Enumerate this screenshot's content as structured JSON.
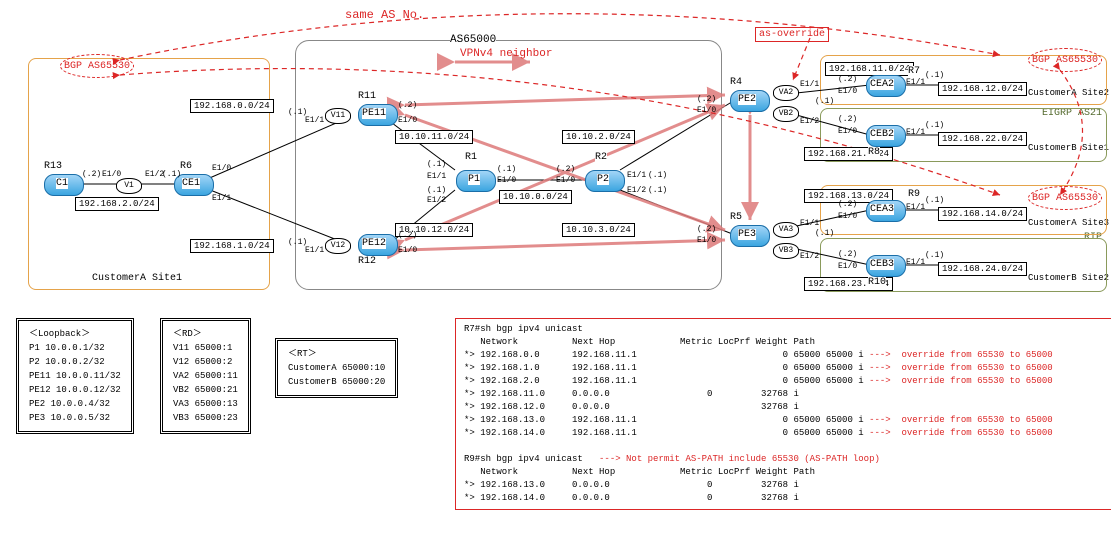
{
  "annotations": {
    "same_as": "same AS No.",
    "as_override": "as-override",
    "as65000": "AS65000",
    "vpnv4": "VPNv4 neighbor",
    "bgp65530": "BGP AS65530",
    "eigrp": "EIGRP AS21",
    "rip": "RIP",
    "custA1": "CustomerA Site1",
    "custA2": "CustomerA Site2",
    "custA3": "CustomerA Site3",
    "custB1": "CustomerB Site1",
    "custB2": "CustomerB Site2"
  },
  "routers": {
    "R1": "R1",
    "R2": "R2",
    "R4": "R4",
    "R5": "R5",
    "R6": "R6",
    "R7": "R7",
    "R8": "R8",
    "R9": "R9",
    "R10": "R10",
    "R11": "R11",
    "R12": "R12",
    "R13": "R13",
    "P1": "P1",
    "P2": "P2",
    "PE11": "PE11",
    "PE12": "PE12",
    "PE2": "PE2",
    "PE3": "PE3",
    "CE1": "CE1",
    "C1": "C1",
    "CEA2": "CEA2",
    "CEB2": "CEB2",
    "CEA3": "CEA3",
    "CEB3": "CEB3",
    "V1": "V1",
    "V11": "V11",
    "V12": "V12",
    "VA2": "VA2",
    "VB2": "VB2",
    "VA3": "VA3",
    "VB3": "VB3"
  },
  "nets": {
    "n_192_168_0": "192.168.0.0/24",
    "n_192_168_1": "192.168.1.0/24",
    "n_192_168_2": "192.168.2.0/24",
    "n_192_168_11": "192.168.11.0/24",
    "n_192_168_12": "192.168.12.0/24",
    "n_192_168_13": "192.168.13.0/24",
    "n_192_168_14": "192.168.14.0/24",
    "n_192_168_21": "192.168.21.0/24",
    "n_192_168_22": "192.168.22.0/24",
    "n_192_168_23": "192.168.23.0/24",
    "n_192_168_24": "192.168.24.0/24",
    "n_10_10_0": "10.10.0.0/24",
    "n_10_10_2": "10.10.2.0/24",
    "n_10_10_3": "10.10.3.0/24",
    "n_10_10_11": "10.10.11.0/24",
    "n_10_10_12": "10.10.12.0/24"
  },
  "ports": {
    "e10": "E1/0",
    "e11": "E1/1",
    "e12": "E1/2",
    "p1": "(.1)",
    "p2": "(.2)"
  },
  "loopback": {
    "title": "＜Loopback＞",
    "lines": [
      "P1 10.0.0.1/32",
      "P2 10.0.0.2/32",
      "PE11 10.0.0.11/32",
      "PE12 10.0.0.12/32",
      "PE2 10.0.0.4/32",
      "PE3 10.0.0.5/32"
    ]
  },
  "rd": {
    "title": "＜RD＞",
    "lines": [
      "V11 65000:1",
      "V12 65000:2",
      "VA2 65000:11",
      "VB2 65000:21",
      "VA3 65000:13",
      "VB3 65000:23"
    ]
  },
  "rt": {
    "title": "＜RT＞",
    "lines": [
      "CustomerA 65000:10",
      "CustomerB 65000:20"
    ]
  },
  "bgp": {
    "r7_cmd": "R7#sh bgp ipv4 unicast",
    "hdr": "   Network          Next Hop            Metric LocPrf Weight Path",
    "r7_rows": [
      "*> 192.168.0.0      192.168.11.1                           0 65000 65000 i",
      "*> 192.168.1.0      192.168.11.1                           0 65000 65000 i",
      "*> 192.168.2.0      192.168.11.1                           0 65000 65000 i",
      "*> 192.168.11.0     0.0.0.0                  0         32768 i",
      "*> 192.168.12.0     0.0.0.0                            32768 i",
      "*> 192.168.13.0     192.168.11.1                           0 65000 65000 i",
      "*> 192.168.14.0     192.168.11.1                           0 65000 65000 i"
    ],
    "override": "--->  override from 65530 to 65000",
    "r9_cmd": "R9#sh bgp ipv4 unicast",
    "r9_note": "---> Not permit AS-PATH include 65530 (AS-PATH loop)",
    "r9_rows": [
      "*> 192.168.13.0     0.0.0.0                  0         32768 i",
      "*> 192.168.14.0     0.0.0.0                  0         32768 i"
    ]
  }
}
